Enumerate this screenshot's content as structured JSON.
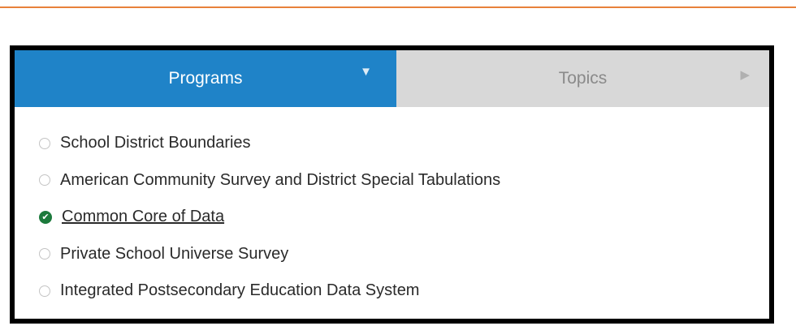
{
  "tabs": [
    {
      "label": "Programs",
      "arrow": "▼",
      "active": true
    },
    {
      "label": "Topics",
      "arrow": "▶",
      "active": false
    }
  ],
  "options": [
    {
      "label": "School District Boundaries",
      "selected": false
    },
    {
      "label": "American Community Survey and District Special Tabulations",
      "selected": false
    },
    {
      "label": "Common Core of Data",
      "selected": true,
      "check_glyph": "✔"
    },
    {
      "label": "Private School Universe Survey",
      "selected": false
    },
    {
      "label": "Integrated Postsecondary Education Data System",
      "selected": false
    }
  ],
  "colors": {
    "accent_rule": "#e8813a",
    "active_tab": "#1f83c8",
    "inactive_tab": "#d8d8d8",
    "selected_check": "#1c7a3c"
  }
}
